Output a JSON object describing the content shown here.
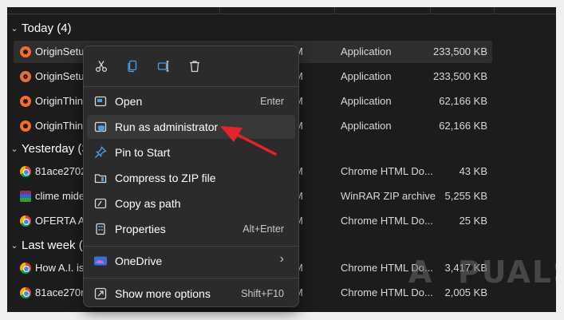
{
  "groups": [
    {
      "label": "Today (4)"
    },
    {
      "label": "Yesterday (3"
    },
    {
      "label": "Last week ("
    }
  ],
  "files": [
    {
      "name": "OriginSetup",
      "date": "M",
      "type": "Application",
      "size": "233,500 KB",
      "icon": "origin-icon"
    },
    {
      "name": "OriginSetup",
      "date": "M",
      "type": "Application",
      "size": "233,500 KB",
      "icon": "origin-icon"
    },
    {
      "name": "OriginThinS",
      "date": "M",
      "type": "Application",
      "size": "62,166 KB",
      "icon": "origin-icon"
    },
    {
      "name": "OriginThinS",
      "date": "M",
      "type": "Application",
      "size": "62,166 KB",
      "icon": "origin-icon"
    },
    {
      "name": "81ace27020",
      "date": "M",
      "type": "Chrome HTML Do...",
      "size": "43 KB",
      "icon": "chrome-icon"
    },
    {
      "name": "clime mide",
      "date": "M",
      "type": "WinRAR ZIP archive",
      "size": "5,255 KB",
      "icon": "winrar-icon"
    },
    {
      "name": "OFERTA AP",
      "date": "M",
      "type": "Chrome HTML Do...",
      "size": "25 KB",
      "icon": "chrome-icon"
    },
    {
      "name": "How A.I. is",
      "date": "M",
      "type": "Chrome HTML Do...",
      "size": "3,417 KB",
      "icon": "chrome-icon"
    },
    {
      "name": "81ace270m",
      "date": "M",
      "type": "Chrome HTML Do...",
      "size": "2,005 KB",
      "icon": "chrome-icon"
    }
  ],
  "context_menu": {
    "toolbar": [
      {
        "name": "cut-icon"
      },
      {
        "name": "copy-icon"
      },
      {
        "name": "rename-icon"
      },
      {
        "name": "delete-icon"
      }
    ],
    "items": [
      {
        "label": "Open",
        "shortcut": "Enter",
        "icon": "open-icon"
      },
      {
        "label": "Run as administrator",
        "shortcut": "",
        "icon": "shield-icon"
      },
      {
        "label": "Pin to Start",
        "shortcut": "",
        "icon": "pin-icon"
      },
      {
        "label": "Compress to ZIP file",
        "shortcut": "",
        "icon": "zip-icon"
      },
      {
        "label": "Copy as path",
        "shortcut": "",
        "icon": "copy-path-icon"
      },
      {
        "label": "Properties",
        "shortcut": "Alt+Enter",
        "icon": "properties-icon"
      },
      {
        "label": "OneDrive",
        "shortcut": "",
        "icon": "onedrive-icon",
        "submenu": true
      },
      {
        "label": "Show more options",
        "shortcut": "Shift+F10",
        "icon": "more-options-icon"
      }
    ]
  },
  "colors": {
    "accent": "#4a9fe8",
    "annotation_arrow": "#e3242b",
    "origin": "#f56c2d"
  },
  "watermark": "A  PUALS"
}
